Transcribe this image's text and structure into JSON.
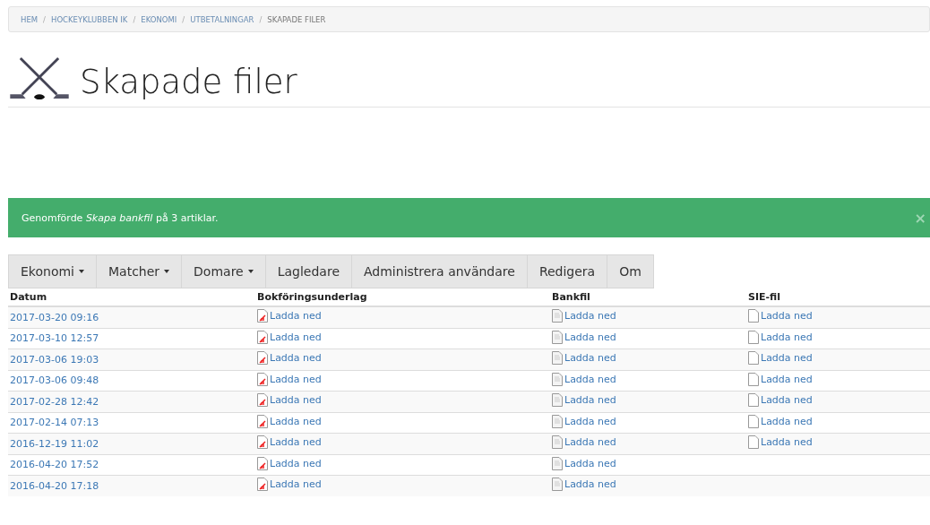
{
  "breadcrumb": {
    "separator": "/",
    "items": [
      {
        "label": "HEM",
        "active": false
      },
      {
        "label": "HOCKEYKLUBBEN IK",
        "active": false
      },
      {
        "label": "EKONOMI",
        "active": false
      },
      {
        "label": "UTBETALNINGAR",
        "active": false
      },
      {
        "label": "SKAPADE FILER",
        "active": true
      }
    ]
  },
  "page_title": "Skapade filer",
  "alert": {
    "message": "Genomförde *Skapa bankfil* på 3 artiklar.",
    "close": "×"
  },
  "menu": [
    {
      "label": "Ekonomi",
      "dropdown": true
    },
    {
      "label": "Matcher",
      "dropdown": true
    },
    {
      "label": "Domare",
      "dropdown": true
    },
    {
      "label": "Lagledare",
      "dropdown": false
    },
    {
      "label": "Administrera användare",
      "dropdown": false
    },
    {
      "label": "Redigera",
      "dropdown": false
    },
    {
      "label": "Om",
      "dropdown": false
    }
  ],
  "table": {
    "columns": [
      "Datum",
      "Bokföringsunderlag",
      "Bankfil",
      "SIE-fil"
    ],
    "rows": [
      {
        "date": "2017-03-20 09:16",
        "bokforing": "Ladda ned",
        "bankfil": "Ladda ned",
        "sie": "Ladda ned"
      },
      {
        "date": "2017-03-10 12:57",
        "bokforing": "Ladda ned",
        "bankfil": "Ladda ned",
        "sie": "Ladda ned"
      },
      {
        "date": "2017-03-06 19:03",
        "bokforing": "Ladda ned",
        "bankfil": "Ladda ned",
        "sie": "Ladda ned"
      },
      {
        "date": "2017-03-06 09:48",
        "bokforing": "Ladda ned",
        "bankfil": "Ladda ned",
        "sie": "Ladda ned"
      },
      {
        "date": "2017-02-28 12:42",
        "bokforing": "Ladda ned",
        "bankfil": "Ladda ned",
        "sie": "Ladda ned"
      },
      {
        "date": "2017-02-14 07:13",
        "bokforing": "Ladda ned",
        "bankfil": "Ladda ned",
        "sie": "Ladda ned"
      },
      {
        "date": "2016-12-19 11:02",
        "bokforing": "Ladda ned",
        "bankfil": "Ladda ned",
        "sie": "Ladda ned"
      },
      {
        "date": "2016-04-20 17:52",
        "bokforing": "Ladda ned",
        "bankfil": "Ladda ned"
      },
      {
        "date": "2016-04-20 17:18",
        "bokforing": "Ladda ned",
        "bankfil": "Ladda ned"
      }
    ]
  }
}
